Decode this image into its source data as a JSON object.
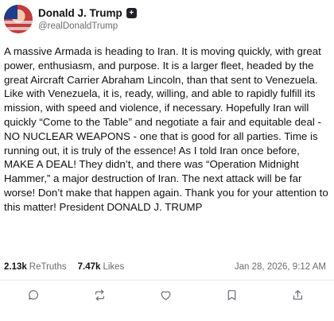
{
  "post": {
    "author": {
      "display_name": "Donald J. Trump",
      "verified_badge": "+",
      "handle": "@realDonaldTrump"
    },
    "text": "A massive Armada is heading to Iran. It is moving quickly, with great power, enthusiasm, and purpose. It is a larger fleet, headed by the great Aircraft Carrier Abraham Lincoln, than that sent to Venezuela. Like with Venezuela, it is, ready, willing, and able to rapidly fulfill its mission, with speed and violence, if necessary. Hopefully Iran will quickly “Come to the Table” and negotiate a fair and equitable deal - NO NUCLEAR WEAPONS - one that is good for all parties. Time is running out, it is truly of the essence! As I told Iran once before, MAKE A DEAL! They didn’t, and there was “Operation Midnight Hammer,” a major destruction of Iran. The next attack will be far worse! Don’t make that happen again. Thank you for your attention to this matter!  President DONALD J. TRUMP",
    "stats": {
      "retruths_count": "2.13k",
      "retruths_label": "ReTruths",
      "likes_count": "7.47k",
      "likes_label": "Likes"
    },
    "timestamp": "Jan 28, 2026, 9:12 AM"
  },
  "actions": {
    "reply_icon": "comment-icon",
    "retruth_icon": "retruth-icon",
    "like_icon": "heart-icon",
    "bookmark_icon": "bookmark-icon",
    "share_icon": "share-icon"
  },
  "colors": {
    "text": "#111111",
    "muted": "#6b6b75",
    "divider": "#ebebef"
  }
}
